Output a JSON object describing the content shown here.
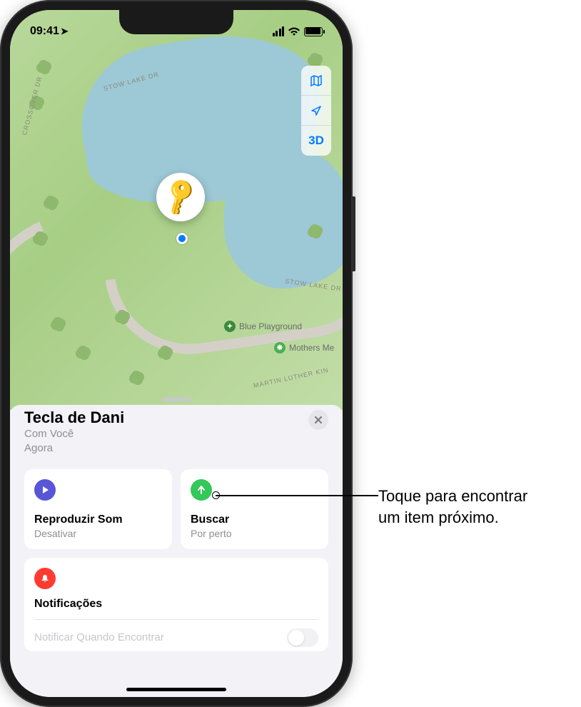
{
  "status": {
    "time": "09:41"
  },
  "map": {
    "controls": {
      "three_d": "3D"
    },
    "roads": {
      "crossover": "CROSSOVER DR",
      "stow_lake": "STOW LAKE DR",
      "mlk": "MARTIN LUTHER KIN"
    },
    "poi": {
      "blue_playground": "Blue Playground",
      "mothers_meadow": "Mothers Me"
    }
  },
  "sheet": {
    "title": "Tecla de Dani",
    "status_line": "Com Você",
    "time_line": "Agora"
  },
  "cards": {
    "play": {
      "title": "Reproduzir Som",
      "sub": "Desativar"
    },
    "find": {
      "title": "Buscar",
      "sub": "Por perto"
    },
    "notify": {
      "title": "Notificações",
      "row_label": "Notificar Quando Encontrar"
    }
  },
  "callout": {
    "line1": "Toque para encontrar",
    "line2": "um item próximo."
  }
}
